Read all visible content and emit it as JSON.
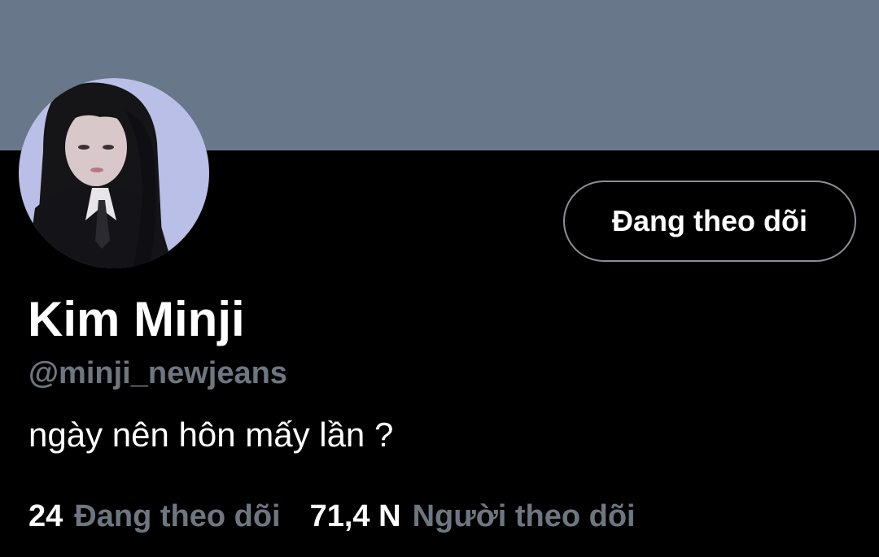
{
  "colors": {
    "banner": "#68778a",
    "background": "#000000",
    "primary_text": "#ffffff",
    "secondary_text": "#6e7681",
    "button_border": "#8a8f96",
    "avatar_bg": "#b9bfe6"
  },
  "profile": {
    "name": "Kim Minji",
    "handle": "@minji_newjeans",
    "bio": "ngày nên hôn mấy lần ?",
    "avatar_icon": "avatar-photo"
  },
  "actions": {
    "follow_state_label": "Đang theo dõi"
  },
  "stats": {
    "following_count": "24",
    "following_label": "Đang theo dõi",
    "followers_count": "71,4 N",
    "followers_label": "Người theo dõi"
  }
}
